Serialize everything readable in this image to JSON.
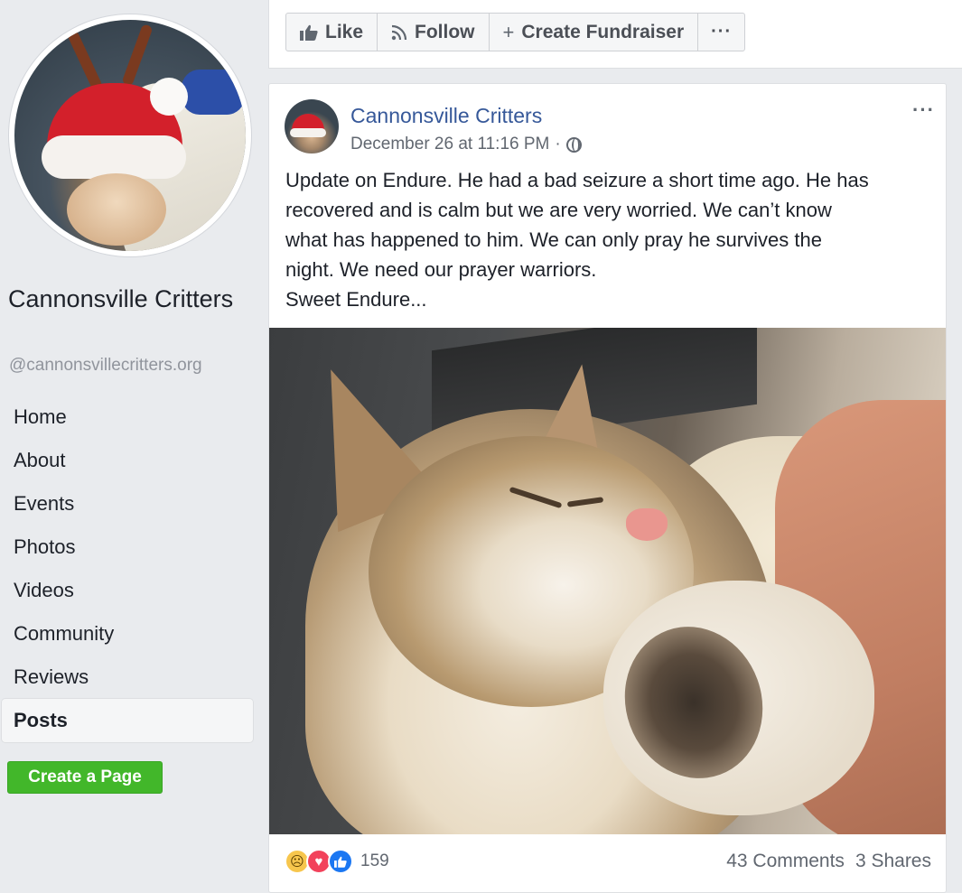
{
  "sidebar": {
    "page_name": "Cannonsville Critters",
    "handle": "@cannonsvillecritters.org",
    "nav": [
      {
        "label": "Home"
      },
      {
        "label": "About"
      },
      {
        "label": "Events"
      },
      {
        "label": "Photos"
      },
      {
        "label": "Videos"
      },
      {
        "label": "Community"
      },
      {
        "label": "Reviews"
      },
      {
        "label": "Posts",
        "active": true
      }
    ],
    "create_page_label": "Create a Page"
  },
  "actions": {
    "like_label": "Like",
    "follow_label": "Follow",
    "fundraiser_label": "Create Fundraiser",
    "more_label": "···"
  },
  "post": {
    "author": "Cannonsville Critters",
    "timestamp": "December 26 at 11:16 PM",
    "separator": "·",
    "options_label": "···",
    "text_lines": [
      "Update on Endure. He had a bad seizure a short time ago. He has",
      "recovered and is calm but we are very worried. We can’t know",
      "what has happened to him. We can only pray he survives the",
      "night. We need our prayer warriors.",
      "Sweet Endure..."
    ],
    "reactions": {
      "count": "159"
    },
    "comments": "43 Comments",
    "shares": "3 Shares"
  },
  "colors": {
    "background": "#e9ebee",
    "link_blue": "#365899",
    "create_green": "#42b72a",
    "love_red": "#f2425b",
    "like_blue": "#1b77f2",
    "sad_yellow": "#f7c64d"
  },
  "icons": {
    "like": "thumbs-up-icon",
    "follow": "rss-icon",
    "fundraiser": "plus-icon",
    "privacy": "globe-icon"
  }
}
